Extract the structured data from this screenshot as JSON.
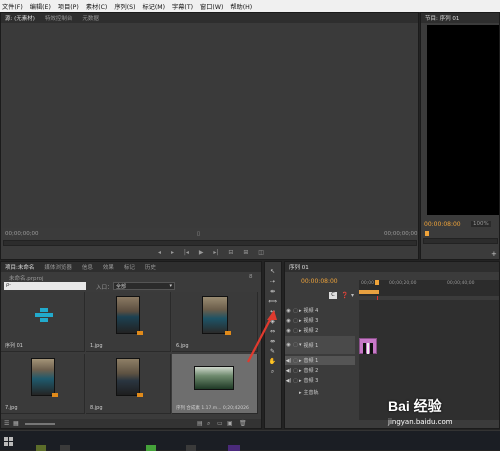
{
  "menu": {
    "items": [
      "文件(F)",
      "编辑(E)",
      "项目(P)",
      "素材(C)",
      "序列(S)",
      "标记(M)",
      "字幕(T)",
      "窗口(W)",
      "帮助(H)"
    ]
  },
  "source_panel": {
    "tabs": [
      "源: (无素材)",
      "特效控制台",
      "元数据"
    ],
    "timecode_left": "00;00;00;00",
    "timecode_right": "00;00;00;00"
  },
  "program_panel": {
    "tab": "节目: 序列 01",
    "timecode": "00:00:08:00",
    "zoom": "100%"
  },
  "project_panel": {
    "tabs": [
      "项目:未命名",
      "媒体浏览器",
      "信息",
      "效果",
      "标记",
      "历史"
    ],
    "project_name": "未命名.prproj",
    "count": "8",
    "search_placeholder": "ρ-",
    "in_label": "入口：",
    "in_value": "全部",
    "items": [
      {
        "label": "序列 01",
        "kind": "sequence"
      },
      {
        "label": "1.jpg",
        "kind": "photo"
      },
      {
        "label": "6.jpg",
        "kind": "photo"
      },
      {
        "label": "7.jpg",
        "kind": "photo"
      },
      {
        "label": "8.jpg",
        "kind": "photo"
      },
      {
        "label": "",
        "kind": "photo"
      },
      {
        "label": "",
        "kind": "photo"
      },
      {
        "label": "序列 合成素  1.17.m... 0;20;42026",
        "kind": "video"
      }
    ]
  },
  "timeline": {
    "tab": "序列 01",
    "timecode": "00:00:08:00",
    "ruler_labels": [
      "00;00",
      "00;00;20;00",
      "00;00;40;00"
    ],
    "video_tracks": [
      "视频 4",
      "视频 3",
      "视频 2",
      "视频 1"
    ],
    "audio_tracks": [
      "音频 1",
      "音频 2",
      "音频 3"
    ],
    "master": "主音轨"
  },
  "watermark": {
    "text": "Bai 经验",
    "url": "jingyan.baidu.com"
  },
  "colors": {
    "accent_orange": "#f0a43a",
    "clip_pink": "#c878c8",
    "playhead_red": "#e03030",
    "arrow_red": "#e03a2e"
  }
}
